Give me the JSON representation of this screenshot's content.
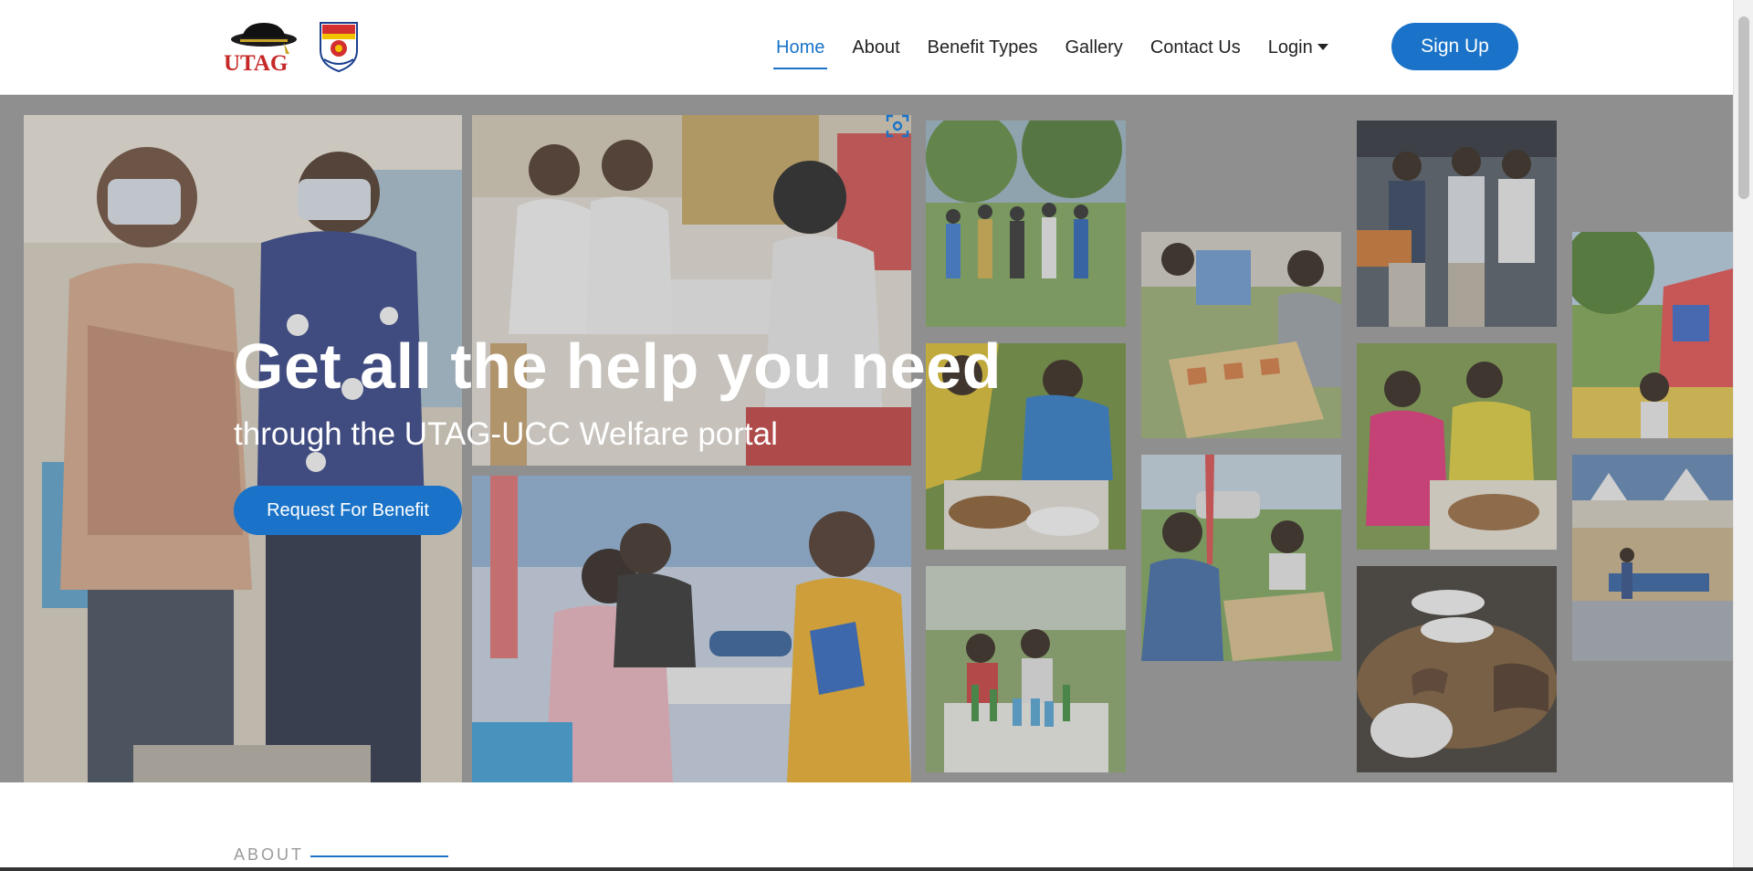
{
  "nav": {
    "logo_text": "UTAG",
    "items": [
      {
        "label": "Home",
        "active": true
      },
      {
        "label": "About",
        "active": false
      },
      {
        "label": "Benefit Types",
        "active": false
      },
      {
        "label": "Gallery",
        "active": false
      },
      {
        "label": "Contact Us",
        "active": false
      },
      {
        "label": "Login",
        "active": false,
        "dropdown": true
      }
    ],
    "signup_label": "Sign Up",
    "accent_color": "#1a73c8"
  },
  "hero": {
    "title": "Get all the help you need",
    "subtitle": "through the UTAG-UCC Welfare portal",
    "cta_label": "Request For Benefit",
    "photo_collage": [
      "health-screening-photo",
      "doctor-consultation-photo",
      "blood-pressure-photo",
      "queue-photo",
      "food-serving-photo",
      "outdoor-drinks-photo",
      "checkers-game-photo",
      "picnic-games-photo",
      "buffet-photo",
      "plates-photo",
      "bouncy-castle-photo",
      "table-tennis-photo"
    ],
    "capture_icon": "screenshot-capture-icon"
  },
  "about": {
    "label": "ABOUT"
  }
}
